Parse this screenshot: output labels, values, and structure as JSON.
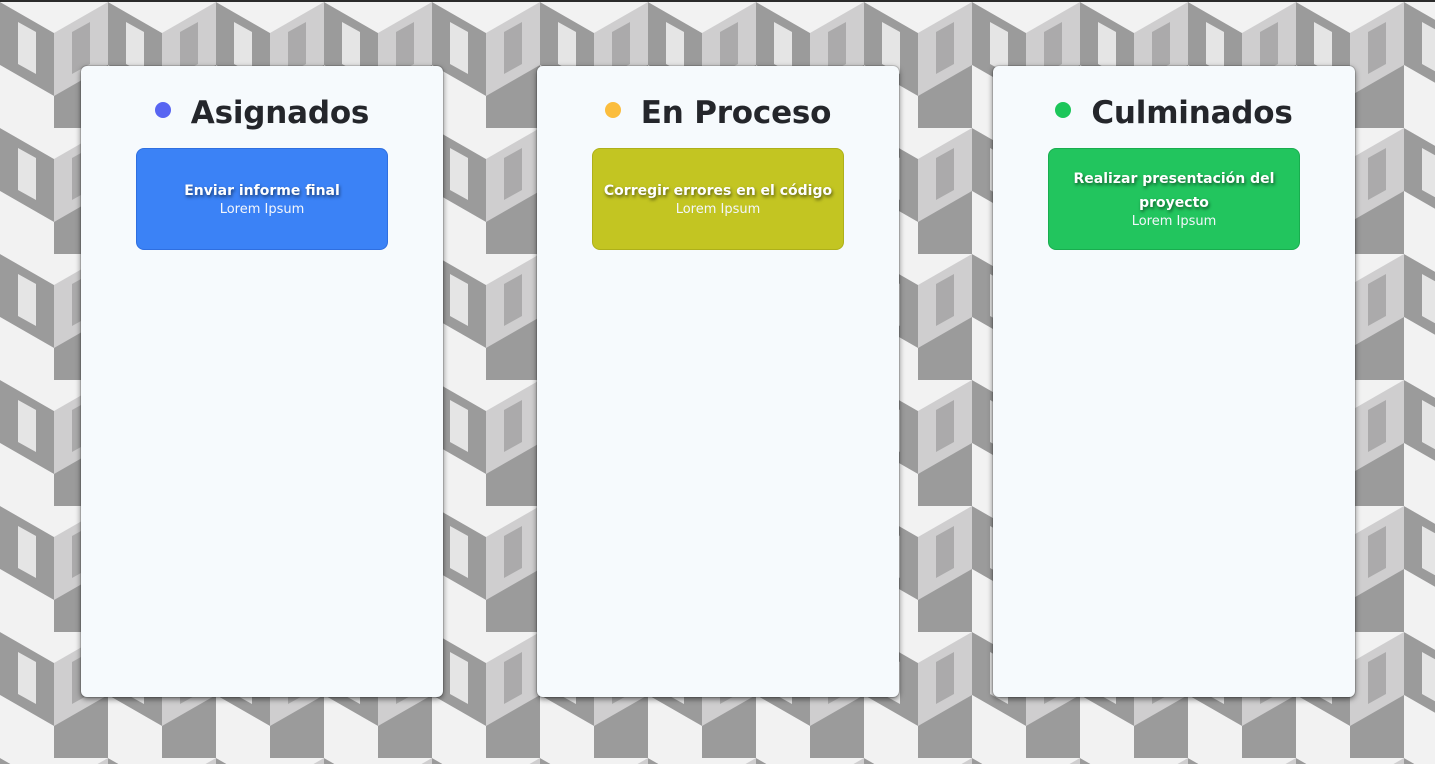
{
  "theme": {
    "column_background": "#f6fafd",
    "title_color": "#24262b",
    "pattern_light": "#f2f2f2",
    "pattern_mid": "#cfcecf",
    "pattern_dark": "#9b9b9b"
  },
  "columns": [
    {
      "title": "Asignados",
      "dot_color": "#5865f2",
      "cards": [
        {
          "title": "Enviar informe final",
          "subtitle": "Lorem Ipsum",
          "color": "#3b82f6",
          "border": "#2f6fe0"
        }
      ]
    },
    {
      "title": "En Proceso",
      "dot_color": "#fbbd3d",
      "cards": [
        {
          "title": "Corregir errores en el código",
          "subtitle": "Lorem Ipsum",
          "color": "#c3c522",
          "border": "#aeb01a"
        }
      ]
    },
    {
      "title": "Culminados",
      "dot_color": "#1cc65a",
      "cards": [
        {
          "title": "Realizar presentación del proyecto",
          "subtitle": "Lorem Ipsum",
          "color": "#22c55e",
          "border": "#19ad4f"
        }
      ]
    }
  ]
}
